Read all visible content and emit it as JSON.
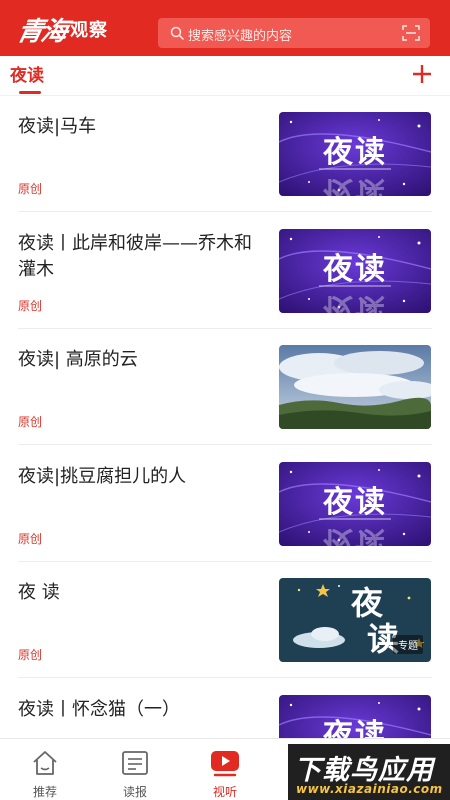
{
  "header": {
    "logo_script": "青海",
    "logo_bold": "观察",
    "search_placeholder": "搜索感兴趣的内容"
  },
  "section": {
    "title": "夜读"
  },
  "feed": [
    {
      "title": "夜读|马车",
      "tag": "原创",
      "thumb": "night-read-purple",
      "thumb_text": "夜读"
    },
    {
      "title": "夜读丨此岸和彼岸——乔木和灌木",
      "tag": "原创",
      "thumb": "night-read-purple",
      "thumb_text": "夜读"
    },
    {
      "title": "夜读| 高原的云",
      "tag": "原创",
      "thumb": "cloud-photo",
      "thumb_text": ""
    },
    {
      "title": "夜读|挑豆腐担儿的人",
      "tag": "原创",
      "thumb": "night-read-purple",
      "thumb_text": "夜读"
    },
    {
      "title": "夜 读",
      "tag": "原创",
      "thumb": "night-read-special",
      "thumb_text": "夜读",
      "thumb_label": "专题"
    },
    {
      "title": "夜读丨怀念猫（一）",
      "tag": "",
      "thumb": "night-read-purple",
      "thumb_text": "夜读"
    }
  ],
  "tabbar": {
    "tabs": [
      {
        "label": "推荐",
        "icon": "home-icon"
      },
      {
        "label": "读报",
        "icon": "newspaper-icon"
      },
      {
        "label": "视听",
        "icon": "video-play-icon",
        "active": true
      }
    ]
  },
  "watermark": {
    "main": "下载鸟应用",
    "sub": "www.xiazainiao.com"
  },
  "colors": {
    "brand_red": "#e02a22",
    "tag_red": "#d8372e",
    "thumb_purple": "#3b1a8f"
  }
}
